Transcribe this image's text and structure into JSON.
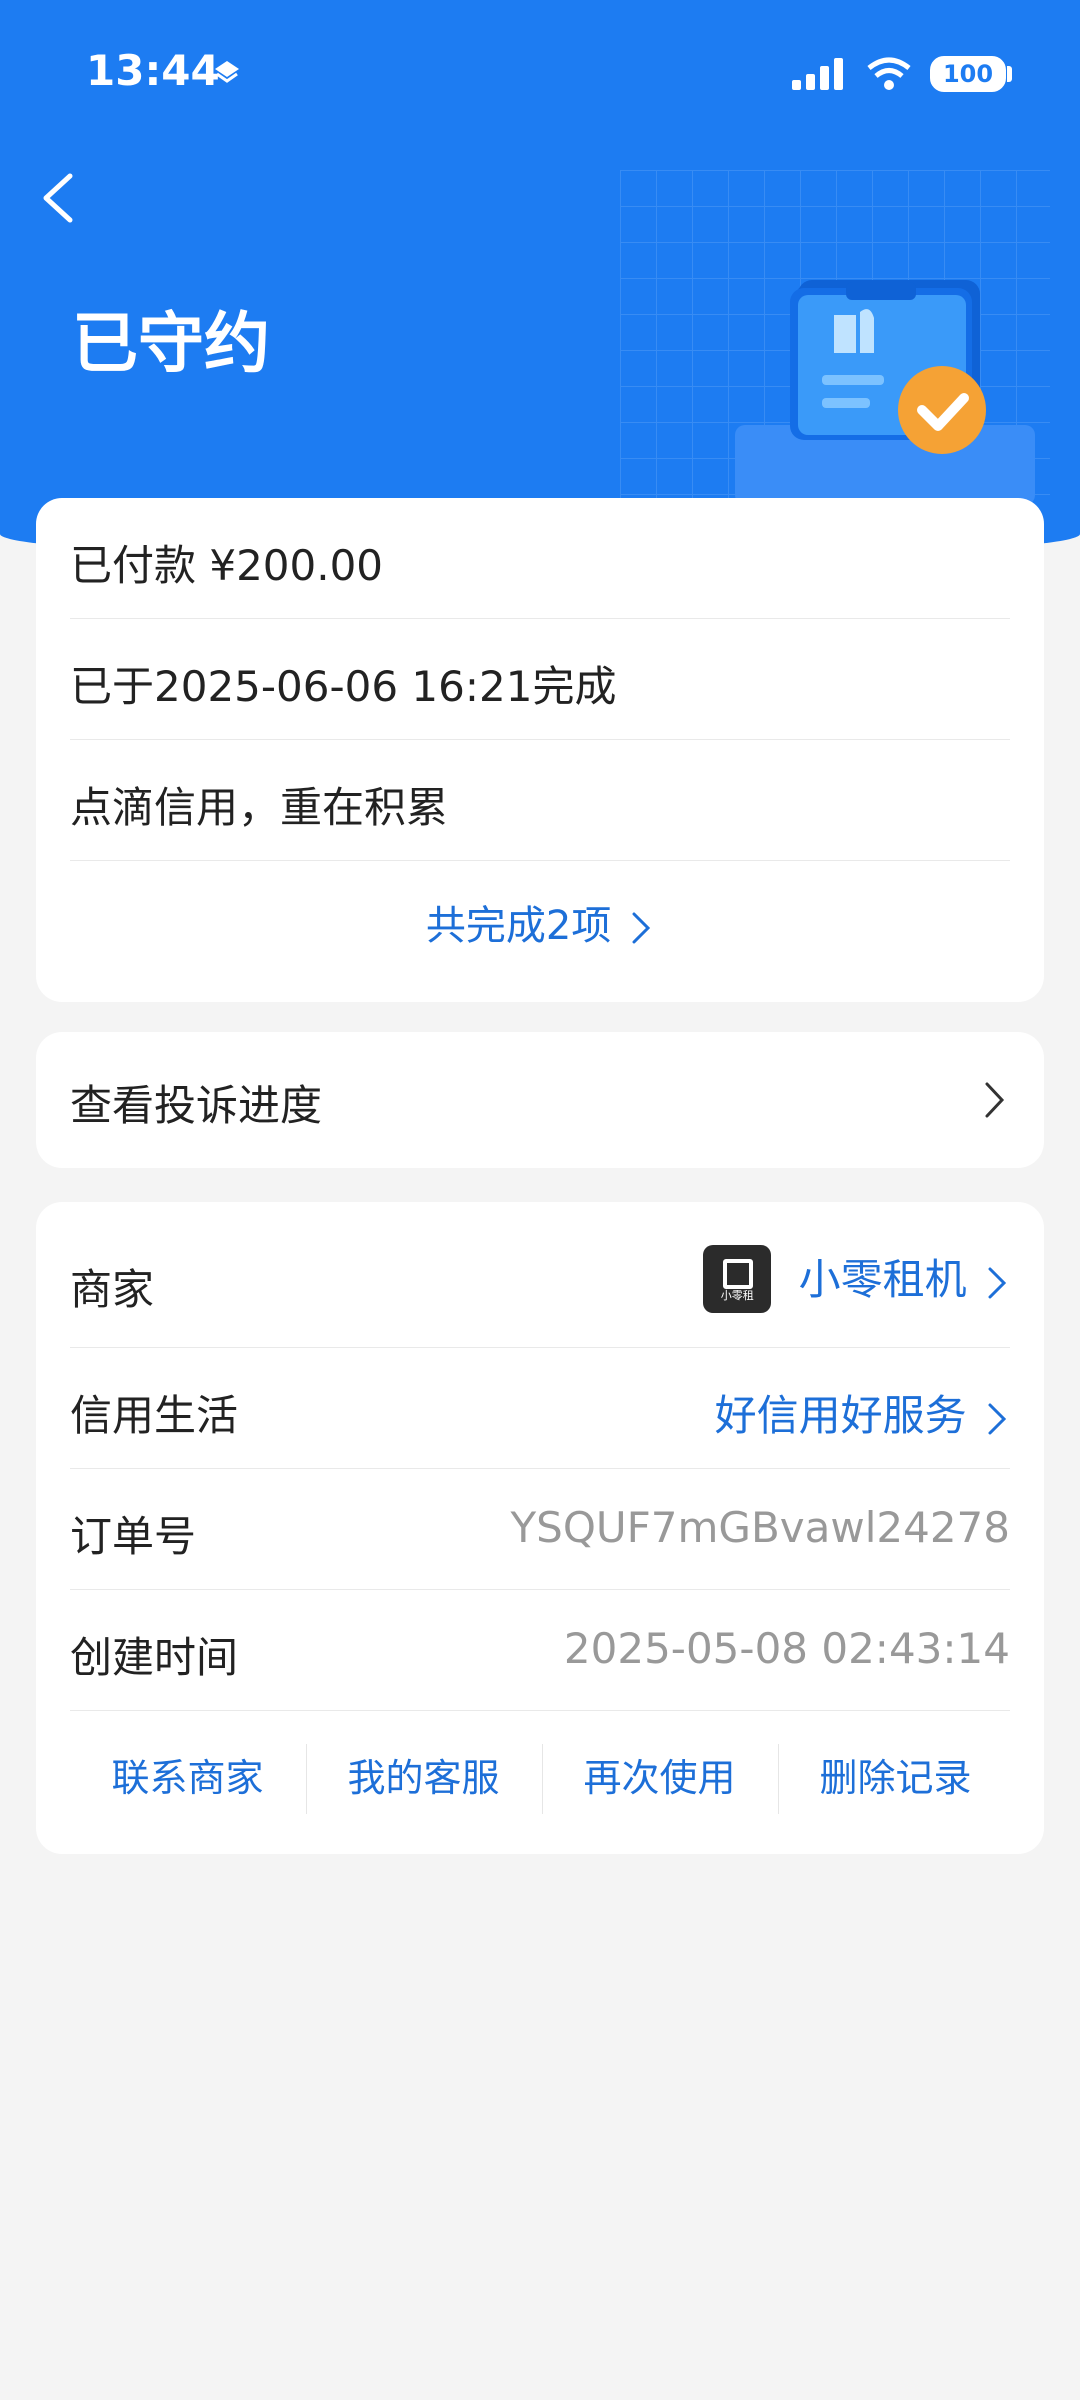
{
  "status_bar": {
    "time": "13:44",
    "battery": "100"
  },
  "header": {
    "title": "已守约"
  },
  "summary": {
    "paid": "已付款 ¥200.00",
    "completed_at": "已于2025-06-06 16:21完成",
    "slogan": "点滴信用，重在积累",
    "completed_link": "共完成2项"
  },
  "complaint": {
    "label": "查看投诉进度"
  },
  "details": {
    "merchant_label": "商家",
    "merchant_value": "小零租机",
    "merchant_logo_text": "小零租",
    "credit_label": "信用生活",
    "credit_value": "好信用好服务",
    "order_label": "订单号",
    "order_value": "YSQUF7mGBvawl24278",
    "created_label": "创建时间",
    "created_value": "2025-05-08 02:43:14"
  },
  "actions": [
    "联系商家",
    "我的客服",
    "再次使用",
    "删除记录"
  ],
  "colors": {
    "primary": "#1d7cf2",
    "link": "#1d6fd8",
    "background": "#f4f4f4"
  }
}
